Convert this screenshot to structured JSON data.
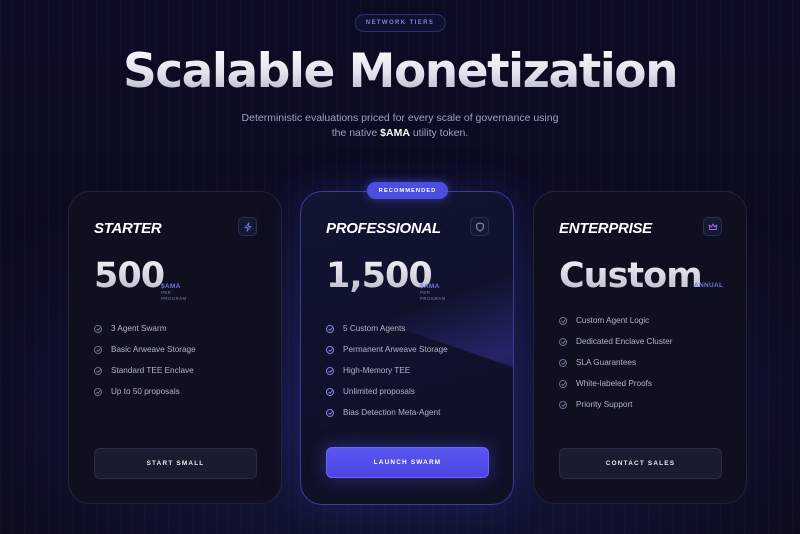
{
  "header": {
    "badge": "NETWORK TIERS",
    "title": "Scalable Monetization",
    "subtitle_line1": "Deterministic evaluations priced for every scale of governance using",
    "subtitle_line2_pre": "the native ",
    "subtitle_token": "$AMA",
    "subtitle_line2_post": " utility token."
  },
  "recommended_label": "RECOMMENDED",
  "plans": [
    {
      "name": "STARTER",
      "icon": "lightning-icon",
      "price": "500",
      "unit": "$AMA",
      "unit_sub1": "PER",
      "unit_sub2": "PROGRAM",
      "features": [
        "3 Agent Swarm",
        "Basic Arweave Storage",
        "Standard TEE Enclave",
        "Up to 50 proposals"
      ],
      "cta": "START SMALL"
    },
    {
      "name": "PROFESSIONAL",
      "icon": "shield-icon",
      "price": "1,500",
      "unit": "$AMA",
      "unit_sub1": "PER",
      "unit_sub2": "PROGRAM",
      "features": [
        "5 Custom Agents",
        "Permanent Arweave Storage",
        "High-Memory TEE",
        "Unlimited proposals",
        "Bias Detection Meta-Agent"
      ],
      "cta": "LAUNCH SWARM"
    },
    {
      "name": "ENTERPRISE",
      "icon": "crown-icon",
      "price": "Custom",
      "unit": "ANNUAL",
      "features": [
        "Custom Agent Logic",
        "Dedicated Enclave Cluster",
        "SLA Guarantees",
        "White-labeled Proofs",
        "Priority Support"
      ],
      "cta": "CONTACT SALES"
    }
  ],
  "colors": {
    "accent": "#4b4fe0",
    "unit": "#6f75e0",
    "background": "#0b0c24"
  }
}
